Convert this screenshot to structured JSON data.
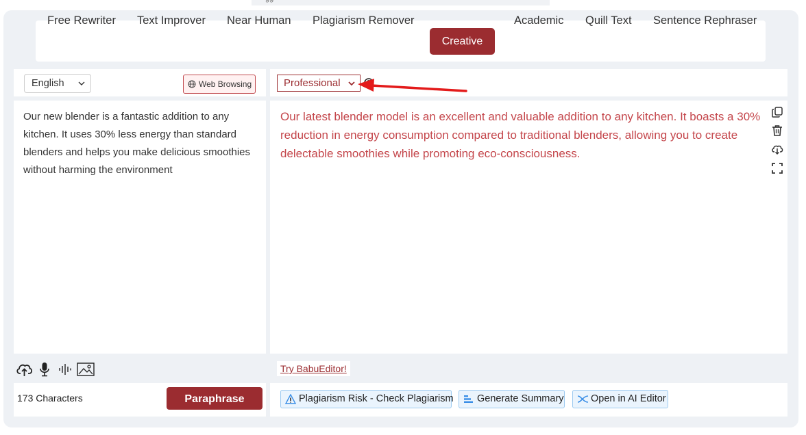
{
  "tabs": [
    {
      "label": "Free Rewriter",
      "active": false
    },
    {
      "label": "Text Improver",
      "active": false
    },
    {
      "label": "Near Human",
      "active": false
    },
    {
      "label": "Plagiarism Remover",
      "active": false
    },
    {
      "label": "Creative",
      "active": true
    },
    {
      "label": "Academic",
      "active": false
    },
    {
      "label": "Quill Text",
      "active": false
    },
    {
      "label": "Sentence Rephraser",
      "active": false
    }
  ],
  "input_panel": {
    "language": "English",
    "web_browsing_label": "Web Browsing",
    "text": "Our new blender is a fantastic addition to any kitchen. It uses 30% less energy than standard blenders and helps you make delicious smoothies without harming the environment",
    "char_count": "173 Characters",
    "paraphrase_label": "Paraphrase",
    "tools": [
      "upload-cloud-icon",
      "microphone-icon",
      "audio-wave-icon",
      "image-icon"
    ]
  },
  "output_panel": {
    "mode": "Professional",
    "text": "Our latest blender model is an excellent and valuable addition to any kitchen. It boasts a 30% reduction in energy consumption compared to traditional blenders, allowing you to create delectable smoothies while promoting eco-consciousness.",
    "try_link": "Try BabuEditor!",
    "actions": [
      "Plagiarism Risk - Check Plagiarism",
      "Generate Summary",
      "Open in AI Editor"
    ],
    "side_icons": [
      "copy-icon",
      "trash-icon",
      "download-icon",
      "fullscreen-icon"
    ]
  },
  "colors": {
    "accent": "#9b2c30",
    "output_text": "#c4464b",
    "action_bg": "#eaf4fd",
    "annotation_arrow": "#e31b1b"
  }
}
